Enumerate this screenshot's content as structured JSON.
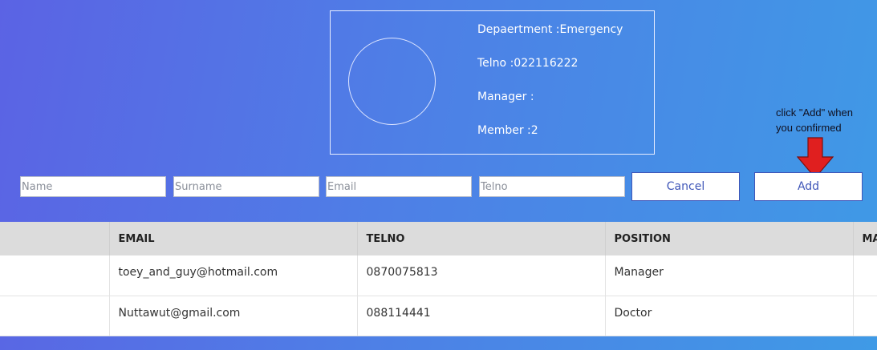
{
  "department": {
    "department_line": "Depaertment :Emergency",
    "telno_line": "Telno :022116222",
    "manager_line": "Manager :",
    "member_line": "Member :2"
  },
  "annotation": {
    "text": "click \"Add\" when you confirmed",
    "arrow_color": "#e01f1f"
  },
  "form": {
    "name_placeholder": "Name",
    "surname_placeholder": "Surname",
    "email_placeholder": "Email",
    "telno_placeholder": "Telno",
    "cancel_label": "Cancel",
    "add_label": "Add"
  },
  "table": {
    "headers": [
      "",
      "EMAIL",
      "TELNO",
      "POSITION",
      "MA"
    ],
    "rows": [
      {
        "c0": "",
        "email": "toey_and_guy@hotmail.com",
        "telno": "0870075813",
        "position": "Manager",
        "c4": ""
      },
      {
        "c0": "",
        "email": "Nuttawut@gmail.com",
        "telno": "088114441",
        "position": "Doctor",
        "c4": ""
      }
    ]
  },
  "colors": {
    "accent": "#3f56b8",
    "header_bg": "#dcdcdc"
  }
}
